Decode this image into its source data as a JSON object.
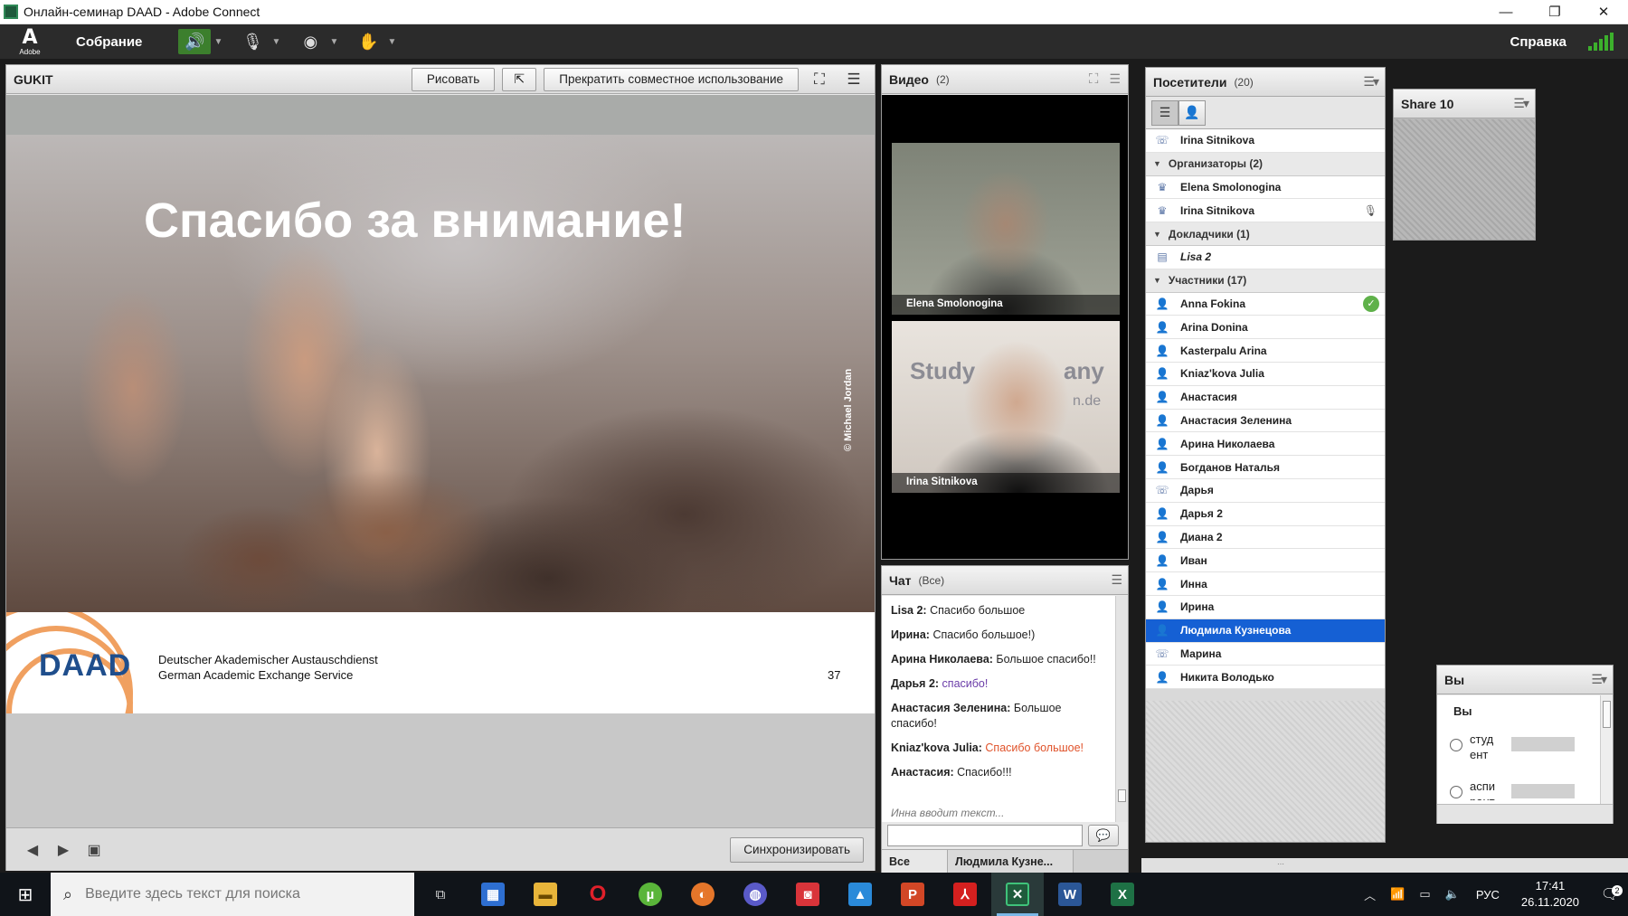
{
  "window": {
    "title": "Онлайн-семинар DAAD - Adobe Connect",
    "minimize": "—",
    "restore": "❐",
    "close": "✕"
  },
  "menubar": {
    "logo_text": "Adobe",
    "meeting": "Собрание",
    "help": "Справка",
    "icons": [
      "speaker-icon",
      "microphone-icon",
      "webcam-icon",
      "raise-hand-icon"
    ]
  },
  "share_pod": {
    "title": "GUKIT",
    "draw_button": "Рисовать",
    "stop_sharing_button": "Прекратить совместное использование",
    "sync_button": "Синхронизировать",
    "slide": {
      "title": "Спасибо за внимание!",
      "credit": "© Michael Jordan",
      "logo": "DAAD",
      "org_line1": "Deutscher Akademischer Austauschdienst",
      "org_line2": "German Academic Exchange Service",
      "page_number": "37"
    }
  },
  "video_pod": {
    "title": "Видео",
    "count": "(2)",
    "tiles": [
      {
        "name": "Elena Smolonogina"
      },
      {
        "name": "Irina Sitnikova",
        "wall_a": "Study",
        "wall_b": "any",
        "wall_c": "n.de"
      }
    ]
  },
  "chat_pod": {
    "title": "Чат",
    "scope": "(Все)",
    "messages": [
      {
        "author": "Lisa 2:",
        "text": "Спасибо большое"
      },
      {
        "author": "Ирина:",
        "text": "Спасибо большое!)"
      },
      {
        "author": "Арина Николаева:",
        "text": "Большое спасибо!!"
      },
      {
        "author": "Дарья 2:",
        "text": "спасибо!"
      },
      {
        "author": "Анастасия Зеленина:",
        "text": "Большое спасибо!"
      },
      {
        "author": "Kniaz'kova Julia:",
        "text": "Спасибо большое!"
      },
      {
        "author": "Анастасия:",
        "text": "Спасибо!!!"
      }
    ],
    "typing": "Инна вводит текст...",
    "input_value": "",
    "tab_all": "Все",
    "tab_private": "Людмила Кузне..."
  },
  "attendees_pod": {
    "title": "Посетители",
    "count": "(20)",
    "host_row": "Irina Sitnikova",
    "groups": [
      {
        "label": "Организаторы (2)",
        "members": [
          "Elena Smolonogina",
          "Irina Sitnikova"
        ]
      },
      {
        "label": "Докладчики (1)",
        "members": [
          "Lisa 2"
        ]
      },
      {
        "label": "Участники (17)",
        "members": [
          "Anna Fokina",
          "Arina Donina",
          "Kasterpalu Arina",
          "Kniaz'kova Julia",
          "Анастасия",
          "Анастасия Зеленина",
          "Арина Николаева",
          "Богданов Наталья",
          "Дарья",
          "Дарья 2",
          "Диана 2",
          "Иван",
          "Инна",
          "Ирина",
          "Людмила Кузнецова",
          "Марина",
          "Никита Володько"
        ]
      }
    ]
  },
  "share10_pod": {
    "title": "Share 10"
  },
  "poll_pod": {
    "title": "Вы",
    "question": "Вы",
    "options": [
      "студ ент",
      "аспи рант"
    ]
  },
  "taskbar": {
    "search_placeholder": "Введите здесь текст для поиска",
    "language": "РУС",
    "time": "17:41",
    "date": "26.11.2020",
    "notifications": "2"
  }
}
